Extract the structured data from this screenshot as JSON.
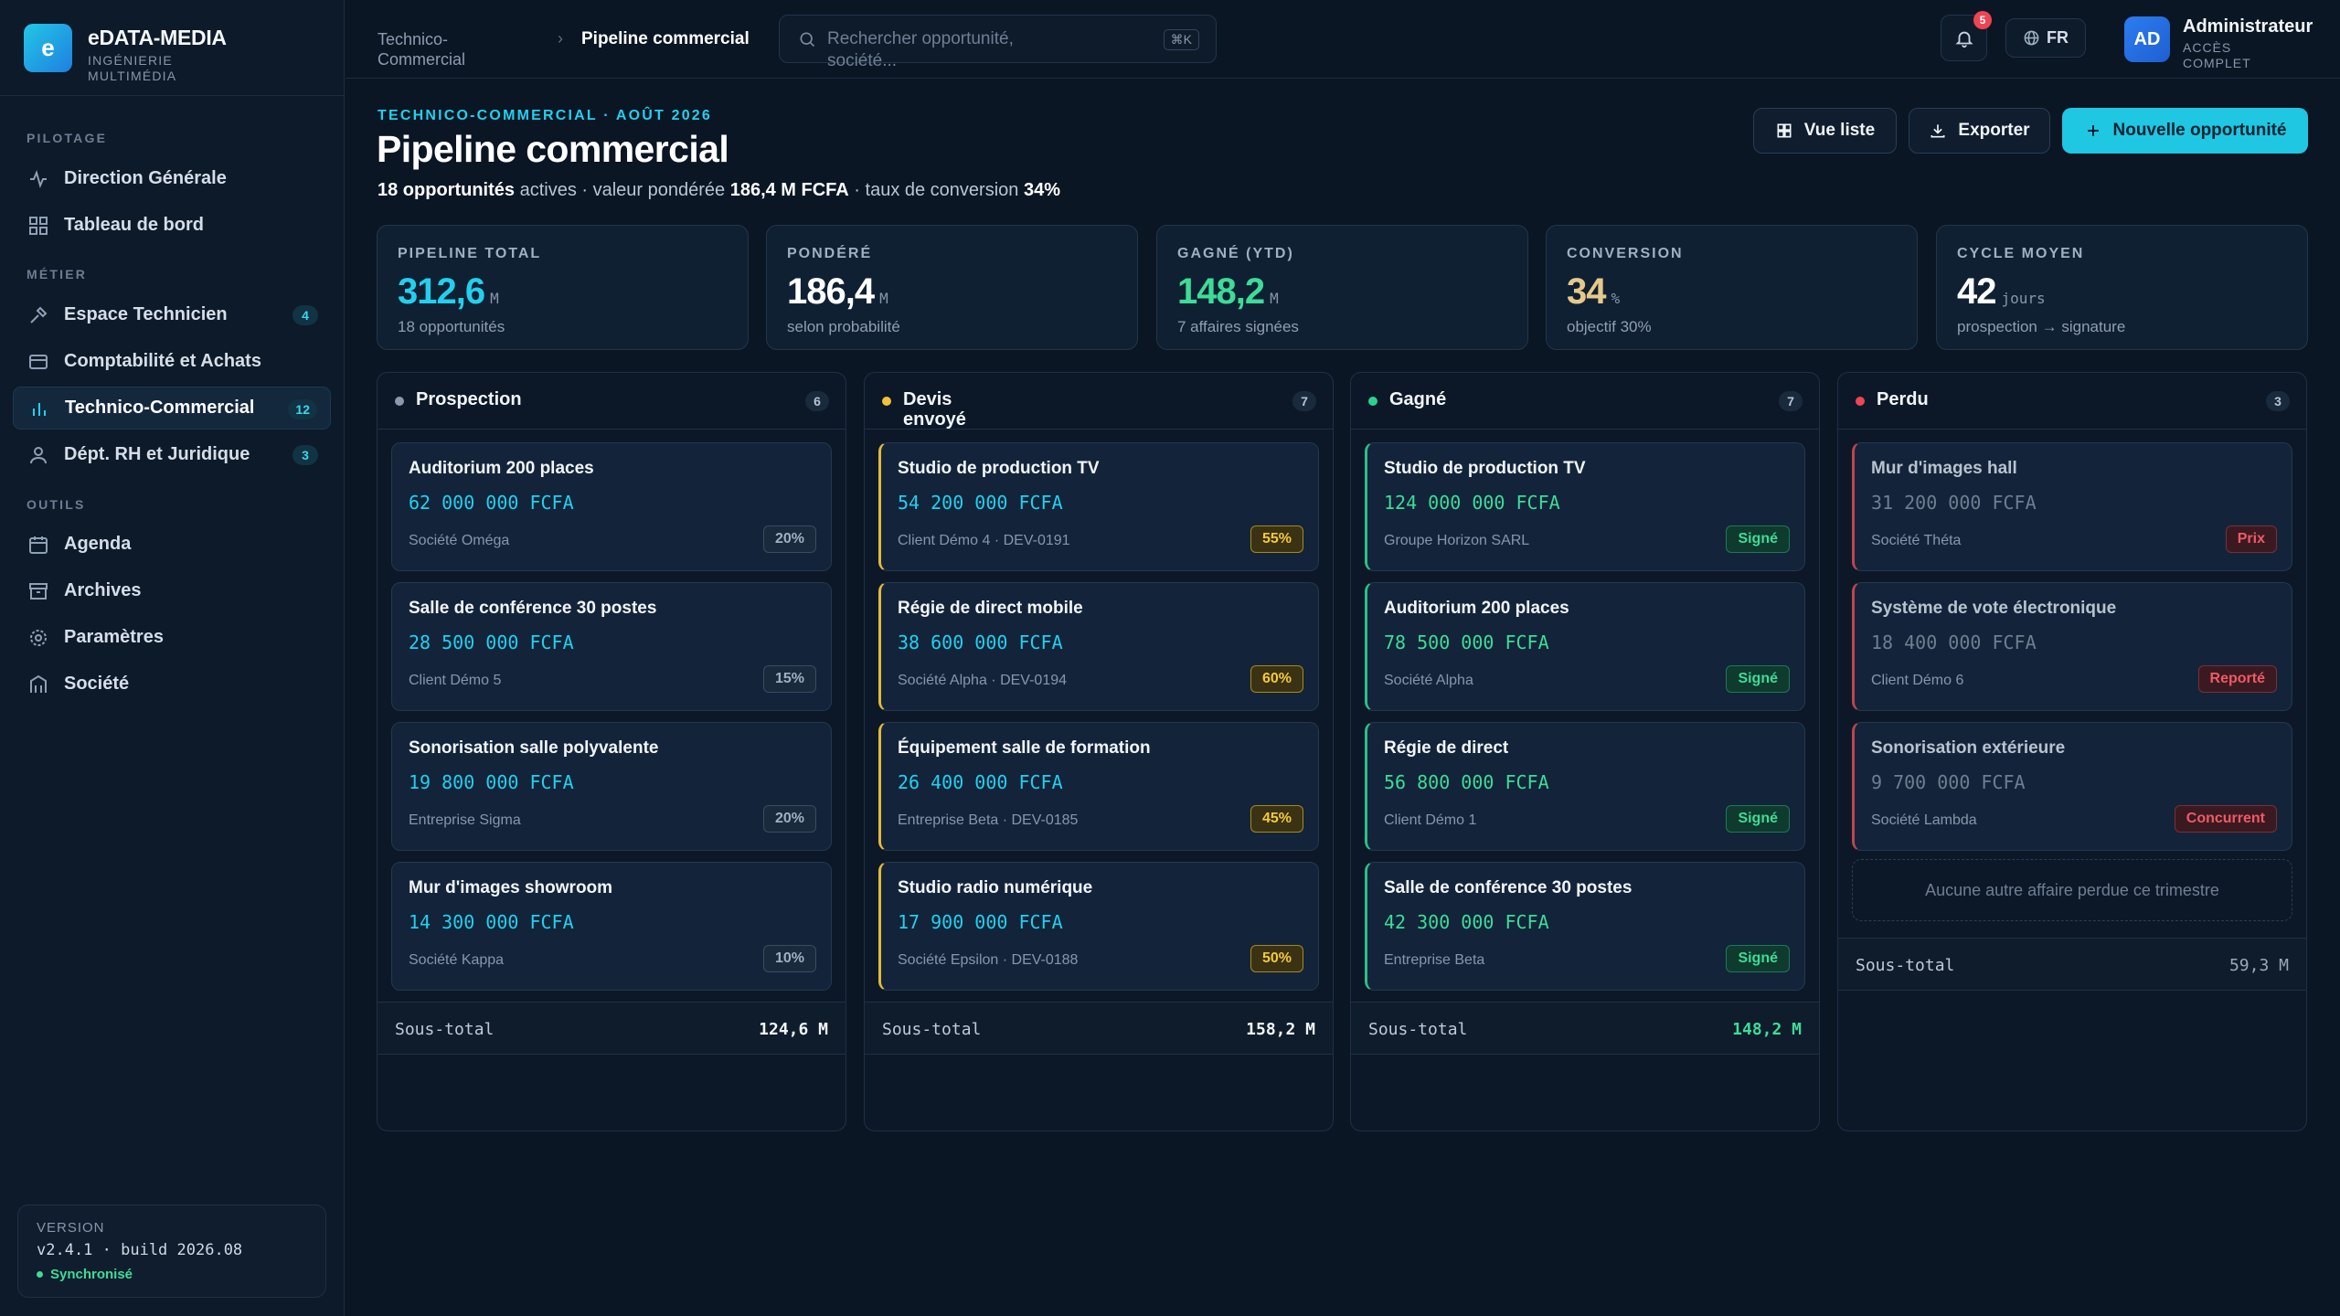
{
  "brand": {
    "logo": "e",
    "name": "eDATA-MEDIA",
    "subtitle": "INGÉNIERIE MULTIMÉDIA"
  },
  "sidebar": {
    "sections": [
      "PILOTAGE",
      "MÉTIER",
      "OUTILS"
    ],
    "pilotage": [
      {
        "label": "Direction Générale",
        "icon": "activity-icon"
      },
      {
        "label": "Tableau de bord",
        "icon": "grid-icon"
      }
    ],
    "metier": [
      {
        "label": "Espace Technicien",
        "icon": "tools-icon",
        "count": "4"
      },
      {
        "label": "Comptabilité et Achats",
        "icon": "card-icon"
      },
      {
        "label": "Technico-Commercial",
        "icon": "bar-chart-icon",
        "count": "12",
        "active": true
      },
      {
        "label": "Dépt. RH et Juridique",
        "icon": "user-icon",
        "count": "3"
      }
    ],
    "outils": [
      {
        "label": "Agenda",
        "icon": "calendar-icon"
      },
      {
        "label": "Archives",
        "icon": "archive-icon"
      },
      {
        "label": "Paramètres",
        "icon": "gear-icon"
      },
      {
        "label": "Société",
        "icon": "building-icon"
      }
    ],
    "version": {
      "title": "VERSION",
      "value": "v2.4.1 · build 2026.08",
      "status": "Synchronisé"
    }
  },
  "topbar": {
    "breadcrumb": [
      "Technico-Commercial",
      "Pipeline commercial"
    ],
    "search_placeholder": "Rechercher opportunité, société...",
    "shortcut": "⌘K",
    "notifications": "5",
    "language": "FR",
    "user": {
      "initials": "AD",
      "name": "Administrateur",
      "role": "ACCÈS COMPLET"
    }
  },
  "page": {
    "eyebrow": "TECHNICO-COMMERCIAL · AOÛT 2026",
    "title": "Pipeline commercial",
    "subtitle": {
      "count": "18 opportunités",
      "t1": " actives · valeur pondérée ",
      "weighted": "186,4 M FCFA",
      "t2": " · taux de conversion ",
      "rate": "34%"
    },
    "actions": {
      "list_view": "Vue liste",
      "export": "Exporter",
      "new": "Nouvelle opportunité"
    }
  },
  "kpis": [
    {
      "label": "PIPELINE TOTAL",
      "value": "312,6",
      "unit": "M",
      "sub": "18 opportunités",
      "color": "#22d0ee"
    },
    {
      "label": "PONDÉRÉ",
      "value": "186,4",
      "unit": "M",
      "sub": "selon probabilité",
      "color": "#ffffff"
    },
    {
      "label": "GAGNÉ (YTD)",
      "value": "148,2",
      "unit": "M",
      "sub": "7 affaires signées",
      "color": "#3ddc97"
    },
    {
      "label": "CONVERSION",
      "value": "34",
      "unit": "%",
      "sub": "objectif 30%",
      "color": "#e6c98a"
    },
    {
      "label": "CYCLE MOYEN",
      "value": "42",
      "unit": "jours",
      "sub": "prospection → signature",
      "color": "#ffffff"
    }
  ],
  "columns": [
    {
      "title": "Prospection",
      "count": "6",
      "color": "#8a99ad",
      "cards": [
        {
          "title": "Auditorium 200 places",
          "amount": "62 000 000 FCFA",
          "client": "Société Oméga",
          "badge": "20%"
        },
        {
          "title": "Salle de conférence 30 postes",
          "amount": "28 500 000 FCFA",
          "client": "Client Démo 5",
          "badge": "15%"
        },
        {
          "title": "Sonorisation salle polyvalente",
          "amount": "19 800 000 FCFA",
          "client": "Entreprise Sigma",
          "badge": "20%"
        },
        {
          "title": "Mur d'images showroom",
          "amount": "14 300 000 FCFA",
          "client": "Société Kappa",
          "badge": "10%"
        }
      ],
      "subtotal_label": "Sous-total",
      "subtotal": "124,6 M"
    },
    {
      "title": "Devis envoyé",
      "count": "7",
      "color": "#f0c23b",
      "cards": [
        {
          "title": "Studio de production TV",
          "amount": "54 200 000 FCFA",
          "client": "Client Démo 4 · DEV-0191",
          "badge": "55%"
        },
        {
          "title": "Régie de direct mobile",
          "amount": "38 600 000 FCFA",
          "client": "Société Alpha · DEV-0194",
          "badge": "60%"
        },
        {
          "title": "Équipement salle de formation",
          "amount": "26 400 000 FCFA",
          "client": "Entreprise Beta · DEV-0185",
          "badge": "45%"
        },
        {
          "title": "Studio radio numérique",
          "amount": "17 900 000 FCFA",
          "client": "Société Epsilon · DEV-0188",
          "badge": "50%"
        }
      ],
      "subtotal_label": "Sous-total",
      "subtotal": "158,2 M"
    },
    {
      "title": "Gagné",
      "count": "7",
      "color": "#2bd18f",
      "cards": [
        {
          "title": "Studio de production TV",
          "amount": "124 000 000 FCFA",
          "client": "Groupe Horizon SARL",
          "badge": "Signé"
        },
        {
          "title": "Auditorium 200 places",
          "amount": "78 500 000 FCFA",
          "client": "Société Alpha",
          "badge": "Signé"
        },
        {
          "title": "Régie de direct",
          "amount": "56 800 000 FCFA",
          "client": "Client Démo 1",
          "badge": "Signé"
        },
        {
          "title": "Salle de conférence 30 postes",
          "amount": "42 300 000 FCFA",
          "client": "Entreprise Beta",
          "badge": "Signé"
        }
      ],
      "subtotal_label": "Sous-total",
      "subtotal": "148,2 M"
    },
    {
      "title": "Perdu",
      "count": "3",
      "color": "#ef4452",
      "cards": [
        {
          "title": "Mur d'images hall",
          "amount": "31 200 000 FCFA",
          "client": "Société Théta",
          "badge": "Prix"
        },
        {
          "title": "Système de vote électronique",
          "amount": "18 400 000 FCFA",
          "client": "Client Démo 6",
          "badge": "Reporté"
        },
        {
          "title": "Sonorisation extérieure",
          "amount": "9 700 000 FCFA",
          "client": "Société Lambda",
          "badge": "Concurrent"
        }
      ],
      "empty": "Aucune autre affaire perdue ce trimestre",
      "subtotal_label": "Sous-total",
      "subtotal": "59,3 M"
    }
  ]
}
